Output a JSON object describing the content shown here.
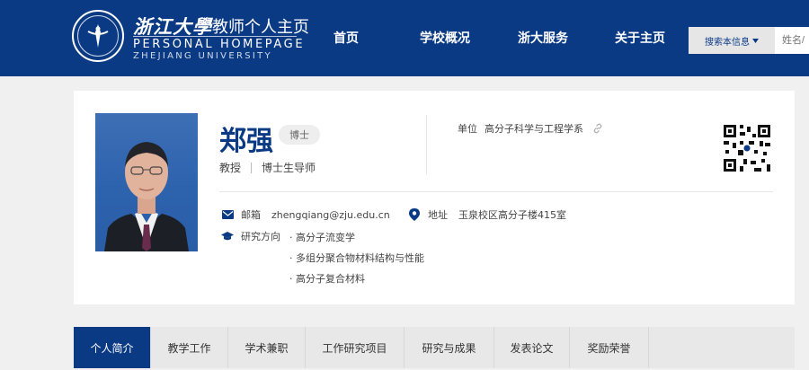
{
  "header": {
    "brand_zh": "浙江大學",
    "brand_sub": "教师个人主页",
    "brand_en": "PERSONAL HOMEPAGE",
    "brand_en2": "ZHEJIANG UNIVERSITY",
    "nav": [
      "首页",
      "学校概况",
      "浙大服务",
      "关于主页"
    ],
    "search": {
      "select_label": "搜索本信息",
      "placeholder": "姓名/"
    }
  },
  "profile": {
    "name": "郑强",
    "degree": "博士",
    "title": "教授",
    "supervisor": "博士生导师",
    "unit_label": "单位",
    "unit_value": "高分子科学与工程学系",
    "email_label": "邮箱",
    "email": "zhengqiang@zju.edu.cn",
    "address_label": "地址",
    "address": "玉泉校区高分子楼415室",
    "research_label": "研究方向",
    "research": [
      "· 高分子流变学",
      "· 多组分聚合物材料结构与性能",
      "· 高分子复合材料"
    ]
  },
  "tabs": [
    "个人简介",
    "教学工作",
    "学术兼职",
    "工作研究项目",
    "研究与成果",
    "发表论文",
    "奖励荣誉"
  ],
  "colors": {
    "brand_blue": "#0b3a85",
    "tab_bar": "#e8e8e8"
  },
  "icons": [
    "zju-seal-logo",
    "caret-down-icon",
    "link-icon",
    "qr-code",
    "mail-icon",
    "location-pin-icon",
    "graduation-cap-icon"
  ]
}
